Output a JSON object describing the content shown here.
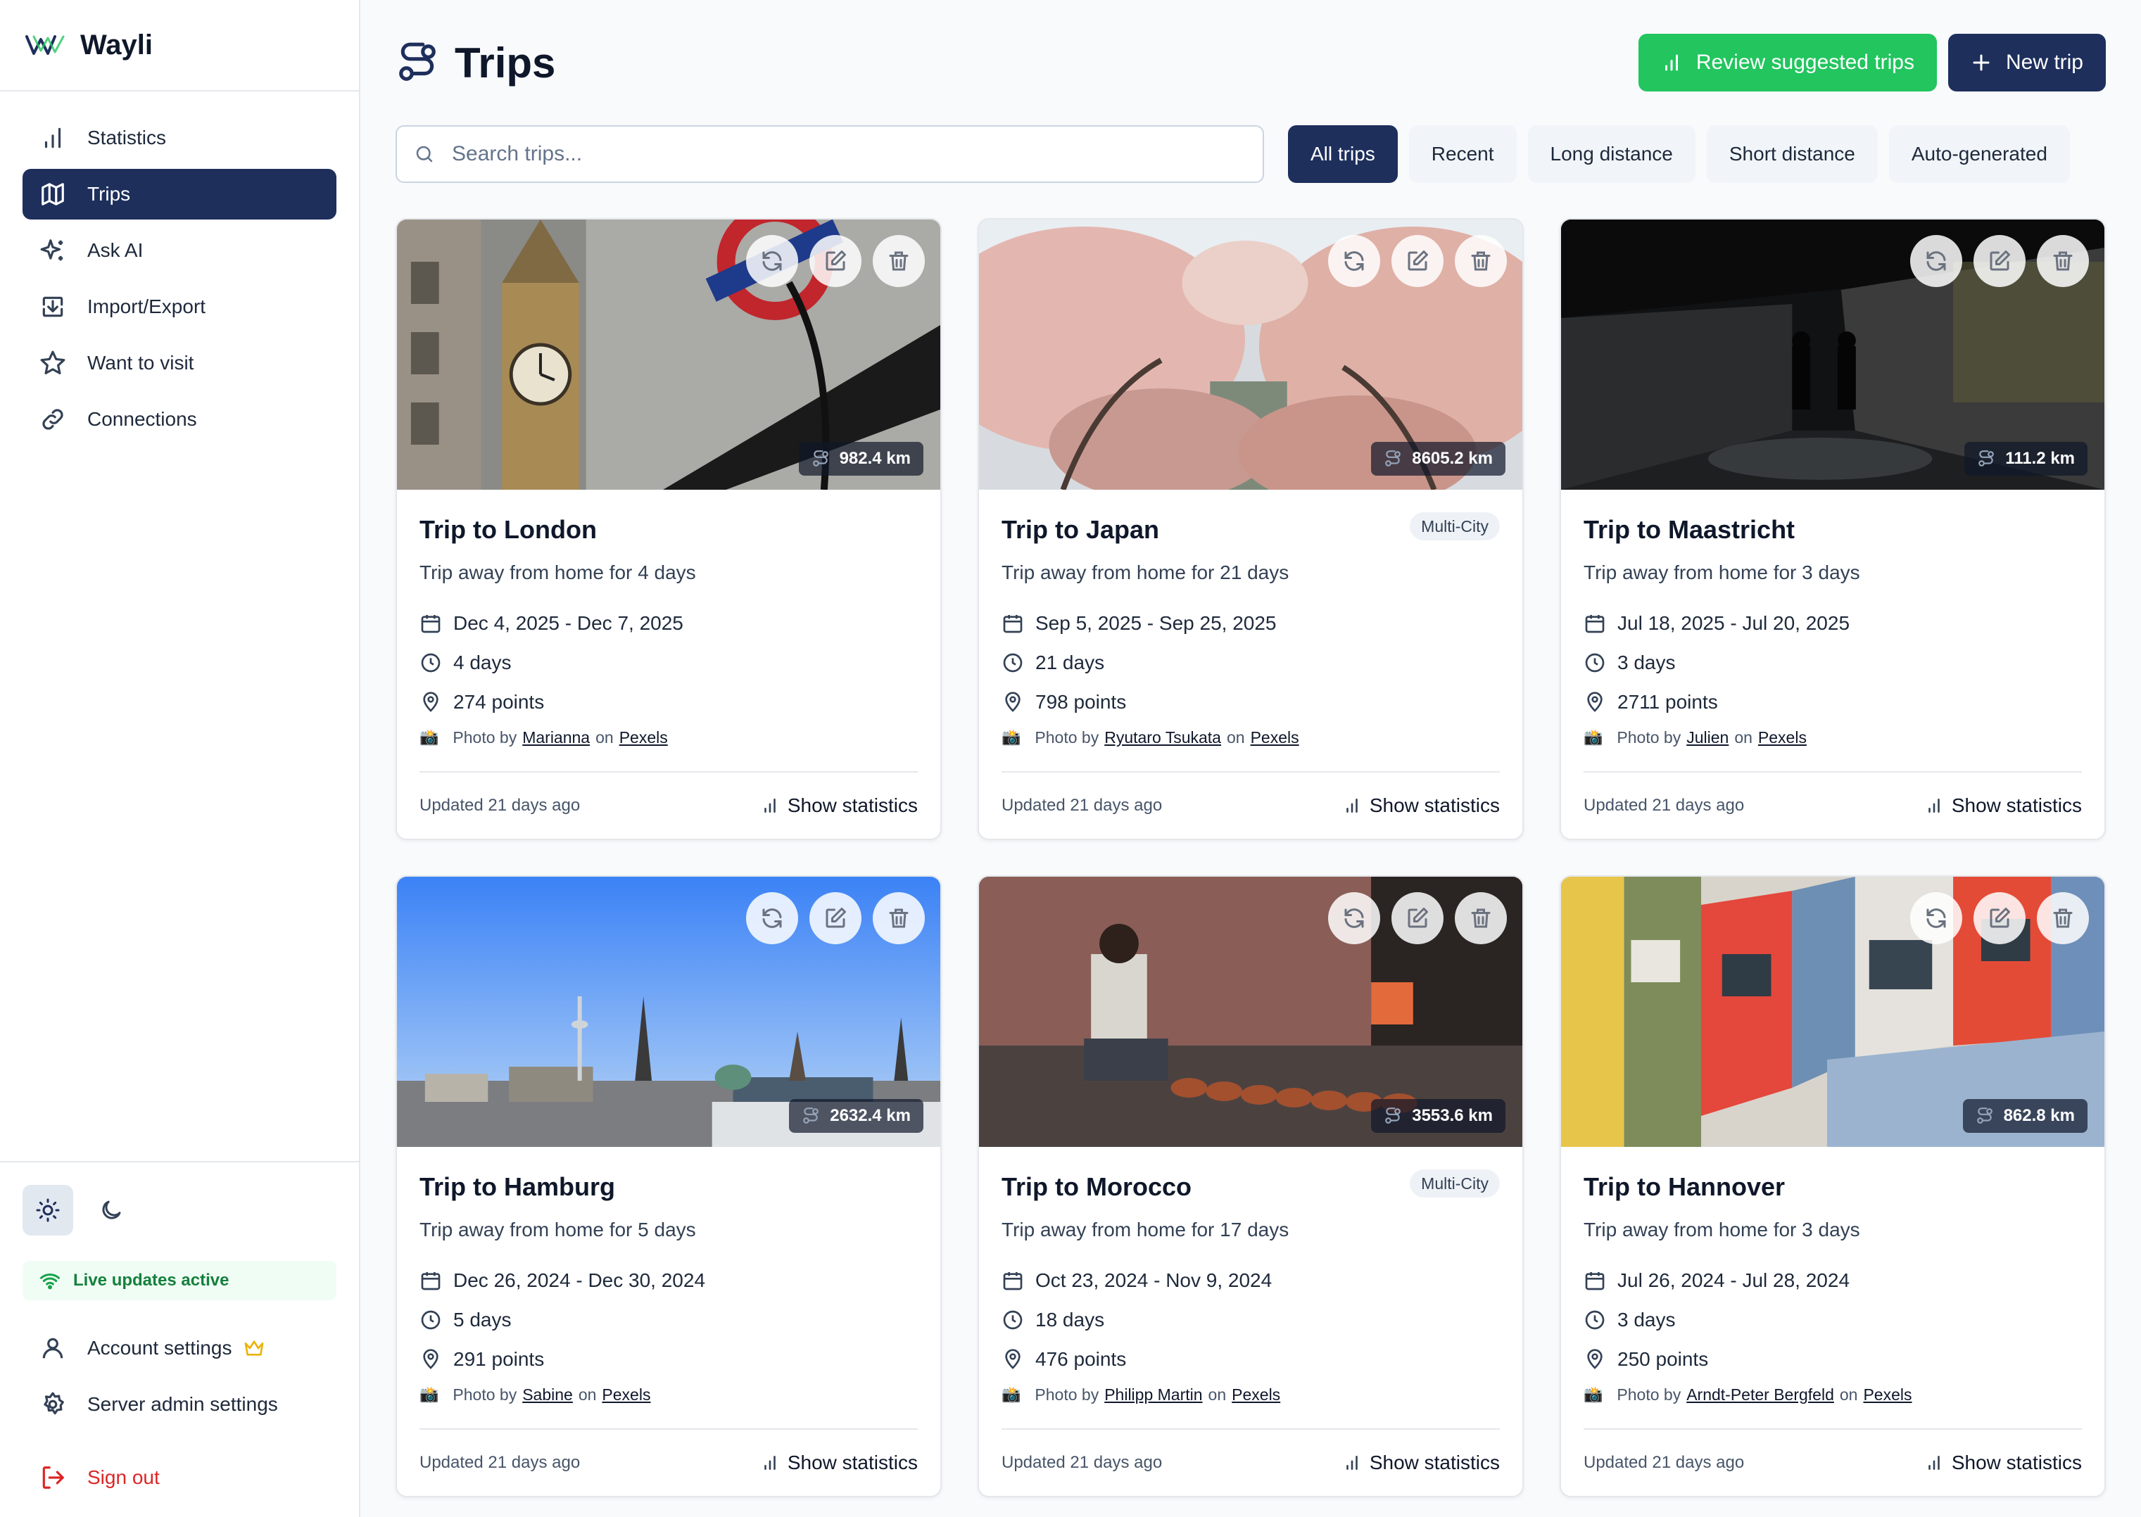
{
  "app": {
    "name": "Wayli"
  },
  "sidebar": {
    "items": [
      {
        "label": "Statistics",
        "icon": "bar-chart-icon"
      },
      {
        "label": "Trips",
        "icon": "map-icon"
      },
      {
        "label": "Ask AI",
        "icon": "sparkles-icon"
      },
      {
        "label": "Import/Export",
        "icon": "import-icon"
      },
      {
        "label": "Want to visit",
        "icon": "star-icon"
      },
      {
        "label": "Connections",
        "icon": "link-icon"
      }
    ],
    "live_status": "Live updates active",
    "account_settings": "Account settings",
    "server_admin": "Server admin settings",
    "sign_out": "Sign out"
  },
  "header": {
    "title": "Trips",
    "review_button": "Review suggested trips",
    "new_trip_button": "New trip"
  },
  "search": {
    "placeholder": "Search trips..."
  },
  "filters": [
    "All trips",
    "Recent",
    "Long distance",
    "Short distance",
    "Auto-generated"
  ],
  "cards": [
    {
      "title": "Trip to London",
      "badge": "",
      "desc": "Trip away from home for 4 days",
      "dates": "Dec 4, 2025 - Dec 7, 2025",
      "duration": "4 days",
      "points": "274 points",
      "distance": "982.4 km",
      "photographer": "Marianna",
      "source": "Pexels",
      "updated": "Updated 21 days ago"
    },
    {
      "title": "Trip to Japan",
      "badge": "Multi-City",
      "desc": "Trip away from home for 21 days",
      "dates": "Sep 5, 2025 - Sep 25, 2025",
      "duration": "21 days",
      "points": "798 points",
      "distance": "8605.2 km",
      "photographer": "Ryutaro Tsukata",
      "source": "Pexels",
      "updated": "Updated 21 days ago"
    },
    {
      "title": "Trip to Maastricht",
      "badge": "",
      "desc": "Trip away from home for 3 days",
      "dates": "Jul 18, 2025 - Jul 20, 2025",
      "duration": "3 days",
      "points": "2711 points",
      "distance": "111.2 km",
      "photographer": "Julien",
      "source": "Pexels",
      "updated": "Updated 21 days ago"
    },
    {
      "title": "Trip to Hamburg",
      "badge": "",
      "desc": "Trip away from home for 5 days",
      "dates": "Dec 26, 2024 - Dec 30, 2024",
      "duration": "5 days",
      "points": "291 points",
      "distance": "2632.4 km",
      "photographer": "Sabine",
      "source": "Pexels",
      "updated": "Updated 21 days ago"
    },
    {
      "title": "Trip to Morocco",
      "badge": "Multi-City",
      "desc": "Trip away from home for 17 days",
      "dates": "Oct 23, 2024 - Nov 9, 2024",
      "duration": "18 days",
      "points": "476 points",
      "distance": "3553.6 km",
      "photographer": "Philipp Martin",
      "source": "Pexels",
      "updated": "Updated 21 days ago"
    },
    {
      "title": "Trip to Hannover",
      "badge": "",
      "desc": "Trip away from home for 3 days",
      "dates": "Jul 26, 2024 - Jul 28, 2024",
      "duration": "3 days",
      "points": "250 points",
      "distance": "862.8 km",
      "photographer": "Arndt-Peter Bergfeld",
      "source": "Pexels",
      "updated": "Updated 21 days ago"
    }
  ],
  "labels": {
    "photo_by": "Photo by",
    "on": "on",
    "show_statistics": "Show statistics"
  },
  "colors": {
    "primary": "#1e2f5c",
    "accent_green": "#22c55e",
    "danger": "#dc2626",
    "live": "#15803d"
  }
}
